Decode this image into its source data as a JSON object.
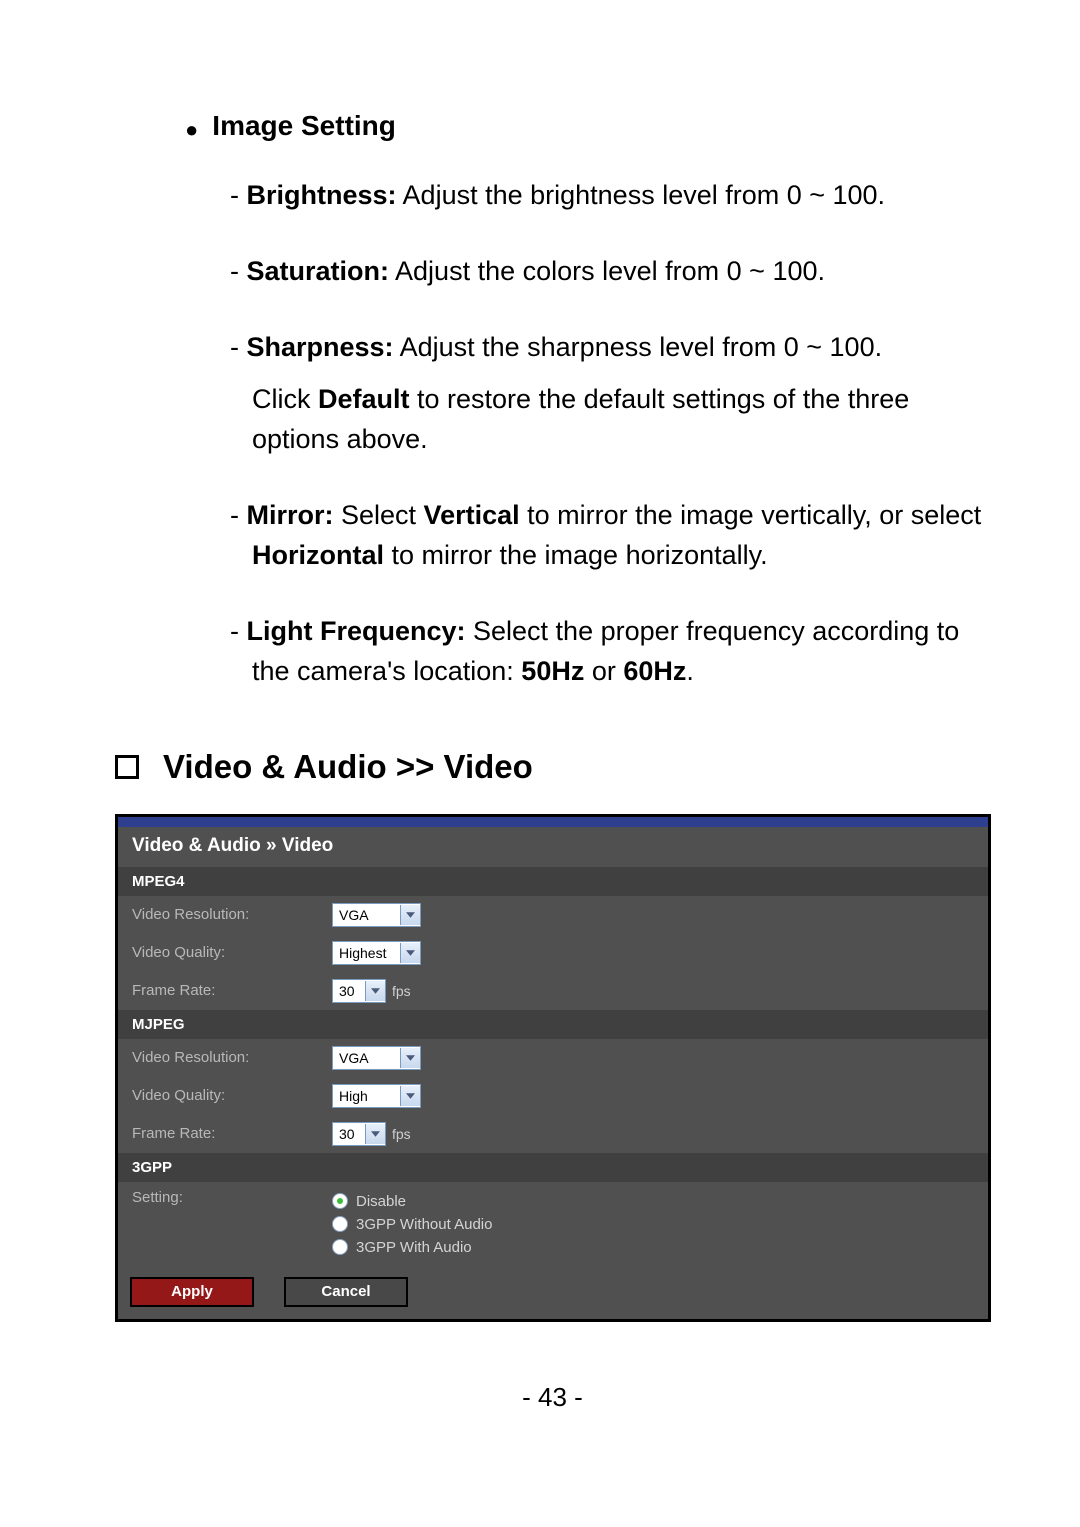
{
  "bullet_title": "Image Setting",
  "items": {
    "brightness": {
      "label": "Brightness:",
      "text": " Adjust the brightness level from 0 ~ 100."
    },
    "saturation": {
      "label": "Saturation:",
      "text": " Adjust the colors level from 0 ~ 100."
    },
    "sharpness": {
      "label": "Sharpness:",
      "text": " Adjust the sharpness level from 0 ~ 100."
    },
    "default_note_a": "Click ",
    "default_note_b": "Default",
    "default_note_c": " to restore the default settings of the three options above.",
    "mirror": {
      "label": "Mirror:",
      "a": " Select ",
      "v": "Vertical",
      "b": " to mirror the image vertically, or select ",
      "h": "Horizontal",
      "c": " to mirror the image horizontally."
    },
    "lightfreq": {
      "label": "Light Frequency:",
      "a": " Select the proper frequency according to the camera's location: ",
      "f1": "50Hz",
      "or": " or ",
      "f2": "60Hz",
      "dot": "."
    }
  },
  "section_heading": "Video & Audio >> Video",
  "panel": {
    "title": "Video & Audio » Video",
    "mpeg4": {
      "band": "MPEG4",
      "resolution_label": "Video Resolution:",
      "resolution_value": "VGA",
      "quality_label": "Video Quality:",
      "quality_value": "Highest",
      "frame_label": "Frame Rate:",
      "frame_value": "30",
      "frame_unit": "fps"
    },
    "mjpeg": {
      "band": "MJPEG",
      "resolution_label": "Video Resolution:",
      "resolution_value": "VGA",
      "quality_label": "Video Quality:",
      "quality_value": "High",
      "frame_label": "Frame Rate:",
      "frame_value": "30",
      "frame_unit": "fps"
    },
    "gpp": {
      "band": "3GPP",
      "setting_label": "Setting:",
      "opt1": "Disable",
      "opt2": "3GPP Without Audio",
      "opt3": "3GPP With Audio"
    },
    "apply": "Apply",
    "cancel": "Cancel"
  },
  "page_number": "- 43 -"
}
